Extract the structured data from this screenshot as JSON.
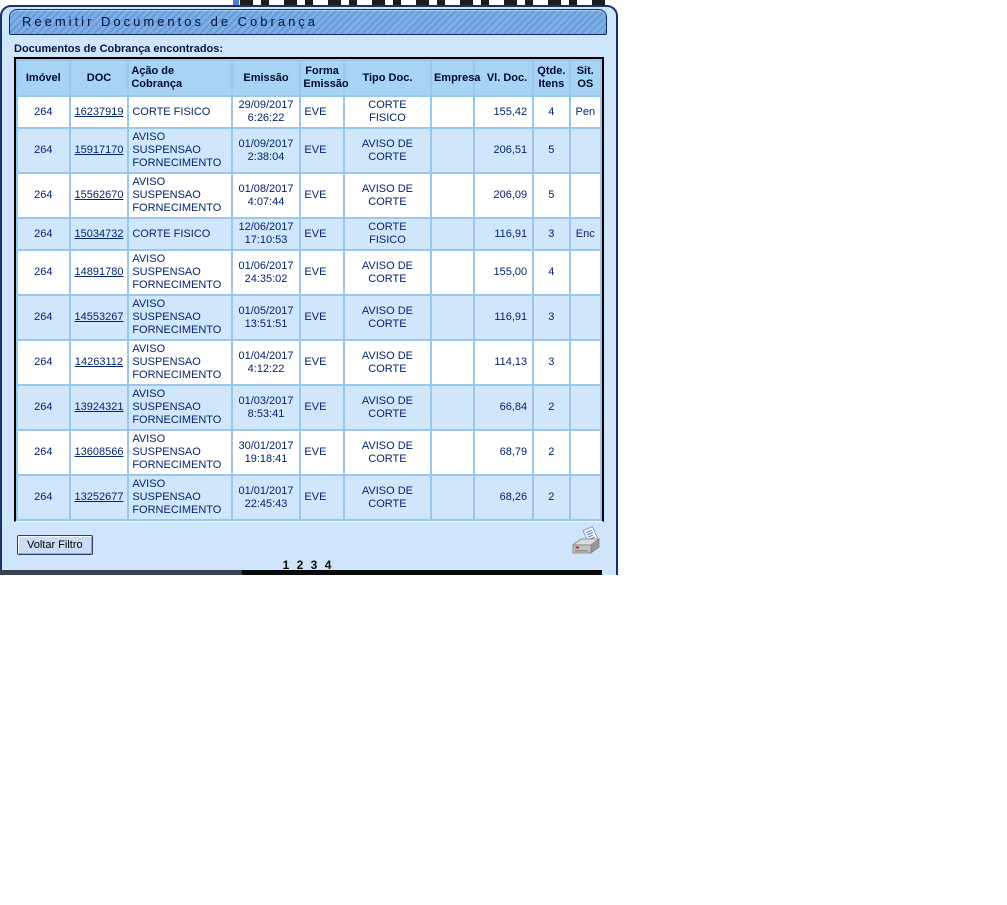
{
  "window": {
    "title": "Reemitir Documentos de Cobrança"
  },
  "found_label": "Documentos de Cobrança encontrados:",
  "table": {
    "columns": [
      {
        "key": "imovel",
        "label": "Imóvel"
      },
      {
        "key": "doc",
        "label": "DOC"
      },
      {
        "key": "acao",
        "label": "Ação de\nCobrança"
      },
      {
        "key": "emissao",
        "label": "Emissão"
      },
      {
        "key": "forma",
        "label": "Forma\nEmissão"
      },
      {
        "key": "tipo",
        "label": "Tipo Doc."
      },
      {
        "key": "empresa",
        "label": "Empresa"
      },
      {
        "key": "vl",
        "label": "Vl. Doc."
      },
      {
        "key": "qtde",
        "label": "Qtde.\nItens"
      },
      {
        "key": "sit",
        "label": "Sit.\nOS"
      }
    ],
    "rows": [
      {
        "imovel": "264",
        "doc": "16237919",
        "acao": "CORTE FISICO",
        "emissao": "29/09/2017\n6:26:22",
        "forma": "EVE",
        "tipo": "CORTE\nFISICO",
        "empresa": "",
        "vl": "155,42",
        "qtde": "4",
        "sit": "Pen"
      },
      {
        "imovel": "264",
        "doc": "15917170",
        "acao": "AVISO SUSPENSAO FORNECIMENTO",
        "emissao": "01/09/2017\n2:38:04",
        "forma": "EVE",
        "tipo": "AVISO DE\nCORTE",
        "empresa": "",
        "vl": "206,51",
        "qtde": "5",
        "sit": ""
      },
      {
        "imovel": "264",
        "doc": "15562670",
        "acao": "AVISO SUSPENSAO FORNECIMENTO",
        "emissao": "01/08/2017\n4:07:44",
        "forma": "EVE",
        "tipo": "AVISO DE\nCORTE",
        "empresa": "",
        "vl": "206,09",
        "qtde": "5",
        "sit": ""
      },
      {
        "imovel": "264",
        "doc": "15034732",
        "acao": "CORTE FISICO",
        "emissao": "12/06/2017\n17:10:53",
        "forma": "EVE",
        "tipo": "CORTE\nFISICO",
        "empresa": "",
        "vl": "116,91",
        "qtde": "3",
        "sit": "Enc"
      },
      {
        "imovel": "264",
        "doc": "14891780",
        "acao": "AVISO SUSPENSAO FORNECIMENTO",
        "emissao": "01/06/2017\n24:35:02",
        "forma": "EVE",
        "tipo": "AVISO DE\nCORTE",
        "empresa": "",
        "vl": "155,00",
        "qtde": "4",
        "sit": ""
      },
      {
        "imovel": "264",
        "doc": "14553267",
        "acao": "AVISO SUSPENSAO FORNECIMENTO",
        "emissao": "01/05/2017\n13:51:51",
        "forma": "EVE",
        "tipo": "AVISO DE\nCORTE",
        "empresa": "",
        "vl": "116,91",
        "qtde": "3",
        "sit": ""
      },
      {
        "imovel": "264",
        "doc": "14263112",
        "acao": "AVISO SUSPENSAO FORNECIMENTO",
        "emissao": "01/04/2017\n4:12:22",
        "forma": "EVE",
        "tipo": "AVISO DE\nCORTE",
        "empresa": "",
        "vl": "114,13",
        "qtde": "3",
        "sit": ""
      },
      {
        "imovel": "264",
        "doc": "13924321",
        "acao": "AVISO SUSPENSAO FORNECIMENTO",
        "emissao": "01/03/2017\n8:53:41",
        "forma": "EVE",
        "tipo": "AVISO DE\nCORTE",
        "empresa": "",
        "vl": "66,84",
        "qtde": "2",
        "sit": ""
      },
      {
        "imovel": "264",
        "doc": "13608566",
        "acao": "AVISO SUSPENSAO FORNECIMENTO",
        "emissao": "30/01/2017\n19:18:41",
        "forma": "EVE",
        "tipo": "AVISO DE\nCORTE",
        "empresa": "",
        "vl": "68,79",
        "qtde": "2",
        "sit": ""
      },
      {
        "imovel": "264",
        "doc": "13252677",
        "acao": "AVISO SUSPENSAO FORNECIMENTO",
        "emissao": "01/01/2017\n22:45:43",
        "forma": "EVE",
        "tipo": "AVISO DE\nCORTE",
        "empresa": "",
        "vl": "68,26",
        "qtde": "2",
        "sit": ""
      }
    ]
  },
  "footer": {
    "back_button": "Voltar Filtro",
    "pages": [
      "1",
      "2",
      "3",
      "4"
    ],
    "printer_icon": "printer-icon"
  },
  "colors": {
    "panel_bg": "#cfe5fb",
    "panel_border": "#16306b",
    "titlebar_bg": "#74a9e6",
    "header_bg": "#a7d3f5",
    "row_alt_bg": "#cfe6fb",
    "grid_gap": "#9cc6ec",
    "text": "#05246b",
    "table_border": "#000000"
  }
}
